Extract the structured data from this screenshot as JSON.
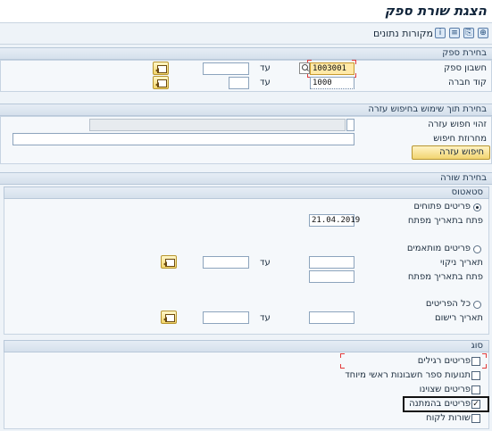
{
  "window": {
    "title": "הצגת שורת ספק"
  },
  "toolbar": {
    "data_sources_label": "מקורות נתונים",
    "icons": [
      "execute-icon",
      "save-variant-icon",
      "list-icon",
      "info-icon"
    ]
  },
  "vendor_selection": {
    "header": "בחירת ספק",
    "vendor_account": {
      "label": "חשבון ספק",
      "from": "1003001",
      "to_label": "עד",
      "to": ""
    },
    "company_code": {
      "label": "קוד חברה",
      "from": "1000",
      "to_label": "עד",
      "to": ""
    }
  },
  "search_help_selection": {
    "header": "בחירת תוך שימוש בחיפוש עזרה",
    "search_help_id_label": "זהוי חפוש עזרה",
    "search_help_id_value": "",
    "search_string_label": "מחרוזת חיפוש",
    "search_string_value": "",
    "search_help_button": "חיפוש עזרה"
  },
  "line_selection": {
    "header": "בחירת שורה",
    "status_header": "סטאטוס",
    "open_items": {
      "label": "פריטים פתוחים",
      "selected": true
    },
    "open_at_key_date": {
      "label": "פתח בתאריך מפתח",
      "value": "21.04.2019"
    },
    "cleared_items": {
      "label": "פריטים מותאמים",
      "selected": false
    },
    "clearing_date": {
      "label": "תאריך ניקוי",
      "from": "",
      "to_label": "עד",
      "to": ""
    },
    "cleared_open_at_key_date": {
      "label": "פתח בתאריך מפתח",
      "value": ""
    },
    "all_items": {
      "label": "כל הפריטים",
      "selected": false
    },
    "posting_date": {
      "label": "תאריך רישום",
      "from": "",
      "to_label": "עד",
      "to": ""
    }
  },
  "type_section": {
    "header": "סוג",
    "normal_items": {
      "label": "פריטים רגילים",
      "checked": false
    },
    "special_gl": {
      "label": "תנועות ספר חשבונות ראשי מיוחד",
      "checked": false
    },
    "noted_items": {
      "label": "פריטים שצוינו",
      "checked": false
    },
    "parked_items": {
      "label": "פריטים בהמתנה",
      "checked": true,
      "mark": "✓"
    },
    "customer_items": {
      "label": "שורות לקוח",
      "checked": false
    }
  },
  "colors": {
    "mandatory_field": "#ffe9a8",
    "section_header": "#d5e0ec",
    "required_marker": "#e23b3b"
  }
}
